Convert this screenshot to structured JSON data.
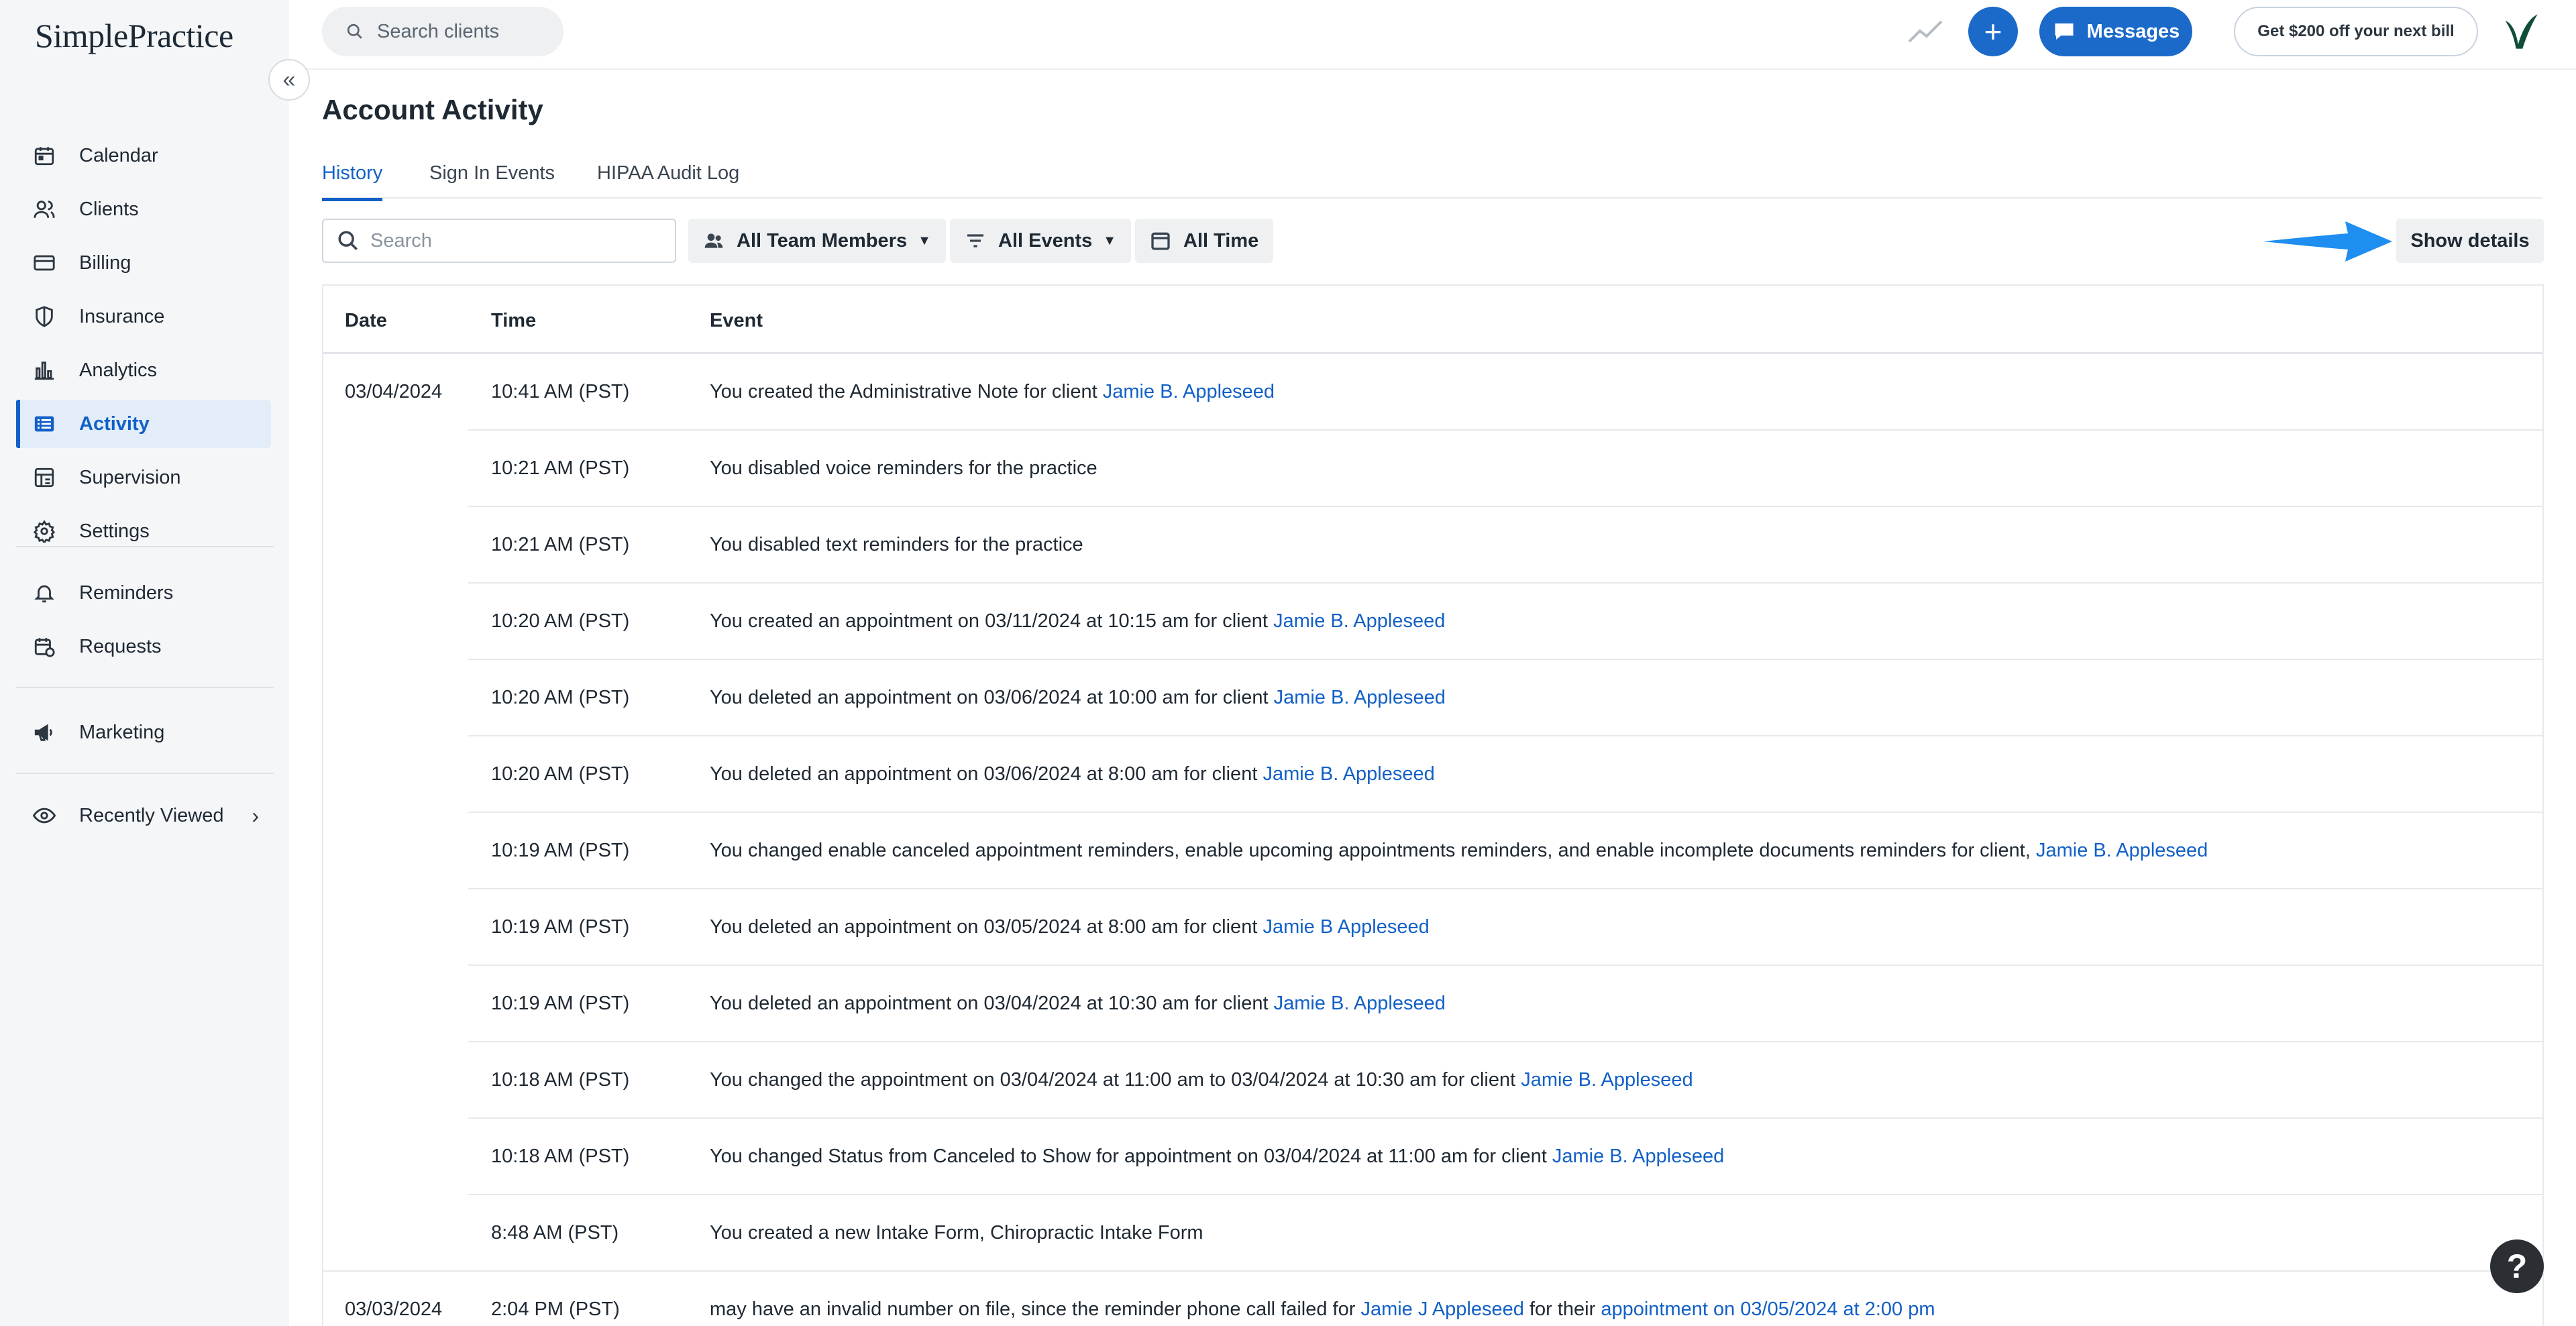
{
  "app": {
    "logo_text": "SimplePractice",
    "brand_color": "#1260c7",
    "accent_green": "#0d7b57"
  },
  "sidebar": {
    "items": [
      {
        "label": "Calendar",
        "icon": "calendar-icon"
      },
      {
        "label": "Clients",
        "icon": "clients-icon"
      },
      {
        "label": "Billing",
        "icon": "billing-icon"
      },
      {
        "label": "Insurance",
        "icon": "shield-icon"
      },
      {
        "label": "Analytics",
        "icon": "bar-chart-icon"
      },
      {
        "label": "Activity",
        "icon": "list-icon",
        "active": true
      },
      {
        "label": "Supervision",
        "icon": "supervision-icon"
      },
      {
        "label": "Settings",
        "icon": "gear-icon"
      },
      {
        "label": "Reminders",
        "icon": "bell-icon"
      },
      {
        "label": "Requests",
        "icon": "requests-icon"
      },
      {
        "label": "Marketing",
        "icon": "megaphone-icon"
      },
      {
        "label": "Recently Viewed",
        "icon": "eye-icon"
      }
    ]
  },
  "topbar": {
    "search_placeholder": "Search clients",
    "messages_label": "Messages",
    "promo_label": "Get $200 off your next bill",
    "plus_label": "+"
  },
  "page": {
    "title": "Account Activity",
    "tabs": [
      "History",
      "Sign In Events",
      "HIPAA Audit Log"
    ],
    "active_tab": "History"
  },
  "filters": {
    "search_placeholder": "Search",
    "team_members": "All Team Members",
    "events": "All Events",
    "time": "All Time",
    "show_details": "Show details"
  },
  "table": {
    "headers": [
      "Date",
      "Time",
      "Event"
    ],
    "rows": [
      {
        "date": "03/04/2024",
        "time": "10:41 AM (PST)",
        "event": "You created the Administrative Note for client ",
        "link": "Jamie B. Appleseed",
        "tail": "",
        "link2": ""
      },
      {
        "date": "",
        "time": "10:21 AM (PST)",
        "event": "You disabled voice reminders for the practice",
        "link": "",
        "tail": "",
        "link2": ""
      },
      {
        "date": "",
        "time": "10:21 AM (PST)",
        "event": "You disabled text reminders for the practice",
        "link": "",
        "tail": "",
        "link2": ""
      },
      {
        "date": "",
        "time": "10:20 AM (PST)",
        "event": "You created an appointment on 03/11/2024 at 10:15 am for client ",
        "link": "Jamie B. Appleseed",
        "tail": "",
        "link2": ""
      },
      {
        "date": "",
        "time": "10:20 AM (PST)",
        "event": "You deleted an appointment on 03/06/2024 at 10:00 am for client ",
        "link": "Jamie B. Appleseed",
        "tail": "",
        "link2": ""
      },
      {
        "date": "",
        "time": "10:20 AM (PST)",
        "event": "You deleted an appointment on 03/06/2024 at 8:00 am for client ",
        "link": "Jamie B. Appleseed",
        "tail": "",
        "link2": ""
      },
      {
        "date": "",
        "time": "10:19 AM (PST)",
        "event": "You changed enable canceled appointment reminders, enable upcoming appointments reminders, and enable incomplete documents reminders for client, ",
        "link": "Jamie B. Appleseed",
        "tail": "",
        "link2": ""
      },
      {
        "date": "",
        "time": "10:19 AM (PST)",
        "event": "You deleted an appointment on 03/05/2024 at 8:00 am for client ",
        "link": "Jamie B Appleseed",
        "tail": "",
        "link2": ""
      },
      {
        "date": "",
        "time": "10:19 AM (PST)",
        "event": "You deleted an appointment on 03/04/2024 at 10:30 am for client ",
        "link": "Jamie B. Appleseed",
        "tail": "",
        "link2": ""
      },
      {
        "date": "",
        "time": "10:18 AM (PST)",
        "event": "You changed the appointment on 03/04/2024 at 11:00 am to 03/04/2024 at 10:30 am for client ",
        "link": "Jamie B. Appleseed",
        "tail": "",
        "link2": ""
      },
      {
        "date": "",
        "time": "10:18 AM (PST)",
        "event": "You changed Status from Canceled to Show for appointment on 03/04/2024 at 11:00 am for client ",
        "link": "Jamie B. Appleseed",
        "tail": "",
        "link2": ""
      },
      {
        "date": "",
        "time": "8:48 AM (PST)",
        "event": "You created a new Intake Form, Chiropractic Intake Form",
        "link": "",
        "tail": "",
        "link2": ""
      },
      {
        "date": "03/03/2024",
        "time": "2:04 PM (PST)",
        "event": "may have an invalid number on file, since the reminder phone call failed for ",
        "link": "Jamie J Appleseed",
        "tail": " for their ",
        "link2": "appointment on 03/05/2024 at 2:00 pm"
      }
    ]
  },
  "help": {
    "label": "?"
  }
}
